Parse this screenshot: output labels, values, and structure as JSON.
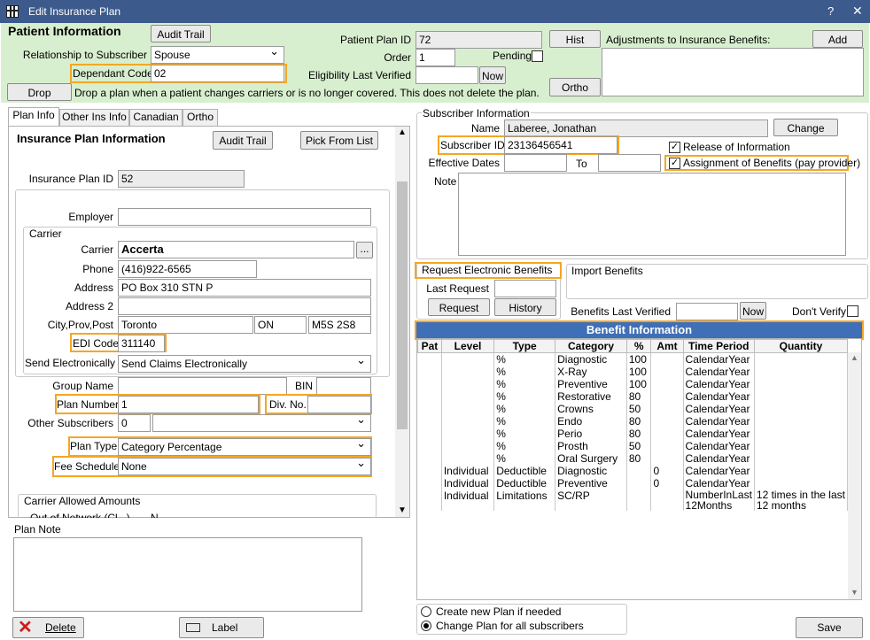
{
  "window": {
    "title": "Edit Insurance Plan",
    "help": "?",
    "close": "✕"
  },
  "patient": {
    "heading": "Patient Information",
    "audit_trail": "Audit Trail",
    "rel_label": "Relationship to Subscriber",
    "rel_value": "Spouse",
    "dep_label": "Dependant Code",
    "dep_value": "02",
    "drop": "Drop",
    "drop_note": "Drop a plan when a patient changes carriers or is no longer covered.  This does not delete the plan.",
    "ppid_label": "Patient Plan ID",
    "ppid_value": "72",
    "hist": "Hist",
    "order_label": "Order",
    "order_value": "1",
    "pending_label": "Pending",
    "elv_label": "Eligibility Last Verified",
    "elv_value": "",
    "now": "Now",
    "ortho": "Ortho",
    "adj_label": "Adjustments to Insurance Benefits:",
    "add": "Add"
  },
  "tabs": [
    "Plan Info",
    "Other Ins Info",
    "Canadian",
    "Ortho"
  ],
  "plan": {
    "heading": "Insurance Plan Information",
    "audit_trail": "Audit Trail",
    "pick": "Pick From List",
    "ipid_label": "Insurance Plan ID",
    "ipid_value": "52",
    "employer_label": "Employer",
    "employer_value": "",
    "carrier_group": "Carrier",
    "carrier_label": "Carrier",
    "carrier_value": "Accerta",
    "ellipsis": "...",
    "phone_label": "Phone",
    "phone_value": "(416)922-6565",
    "addr_label": "Address",
    "addr_value": "PO Box 310  STN P",
    "addr2_label": "Address 2",
    "addr2_value": "",
    "city_label": "City,Prov,Post",
    "city_value": "Toronto",
    "prov_value": "ON",
    "post_value": "M5S 2S8",
    "edi_label": "EDI Code",
    "edi_value": "311140",
    "send_label": "Send Electronically",
    "send_value": "Send Claims Electronically",
    "group_label": "Group Name",
    "group_value": "",
    "bin_label": "BIN",
    "bin_value": "",
    "plannum_label": "Plan Number",
    "plannum_value": "1",
    "div_label": "Div. No.",
    "div_value": "",
    "othersubs_label": "Other Subscribers",
    "othersubs_value": "0",
    "plantype_label": "Plan Type",
    "plantype_value": "Category Percentage",
    "fee_label": "Fee Schedule",
    "fee_value": "None",
    "allowed_label": "Carrier Allowed Amounts",
    "allowed_cut": "Out of Network (Cl...)",
    "allowed_cut_value": "N",
    "note_label": "Plan Note"
  },
  "subscriber": {
    "group": "Subscriber Information",
    "name_label": "Name",
    "name_value": "Laberee, Jonathan",
    "change": "Change",
    "sid_label": "Subscriber ID",
    "sid_value": "23136456541",
    "release_label": "Release of Information",
    "eff_label": "Effective Dates",
    "to_label": "To",
    "assign_label": "Assignment of Benefits (pay provider)",
    "note_label": "Note"
  },
  "electronic": {
    "req_label": "Request Electronic Benefits",
    "last_label": "Last Request",
    "request": "Request",
    "history": "History",
    "import_label": "Import Benefits",
    "blv_label": "Benefits Last Verified",
    "now": "Now",
    "dont_verify": "Don't Verify"
  },
  "benefits": {
    "title": "Benefit Information",
    "columns": [
      "Pat",
      "Level",
      "Type",
      "Category",
      "%",
      "Amt",
      "Time Period",
      "Quantity"
    ],
    "rows": [
      [
        "",
        "",
        "%",
        "Diagnostic",
        "100",
        "",
        "CalendarYear",
        ""
      ],
      [
        "",
        "",
        "%",
        "X-Ray",
        "100",
        "",
        "CalendarYear",
        ""
      ],
      [
        "",
        "",
        "%",
        "Preventive",
        "100",
        "",
        "CalendarYear",
        ""
      ],
      [
        "",
        "",
        "%",
        "Restorative",
        "80",
        "",
        "CalendarYear",
        ""
      ],
      [
        "",
        "",
        "%",
        "Crowns",
        "50",
        "",
        "CalendarYear",
        ""
      ],
      [
        "",
        "",
        "%",
        "Endo",
        "80",
        "",
        "CalendarYear",
        ""
      ],
      [
        "",
        "",
        "%",
        "Perio",
        "80",
        "",
        "CalendarYear",
        ""
      ],
      [
        "",
        "",
        "%",
        "Prosth",
        "50",
        "",
        "CalendarYear",
        ""
      ],
      [
        "",
        "",
        "%",
        "Oral Surgery",
        "80",
        "",
        "CalendarYear",
        ""
      ],
      [
        "",
        "Individual",
        "Deductible",
        "Diagnostic",
        "",
        "0",
        "CalendarYear",
        ""
      ],
      [
        "",
        "Individual",
        "Deductible",
        "Preventive",
        "",
        "0",
        "CalendarYear",
        ""
      ],
      [
        "",
        "Individual",
        "Limitations",
        "SC/RP",
        "",
        "",
        "NumberInLast\n12Months",
        "12 times in the last\n12 months"
      ]
    ]
  },
  "footer": {
    "create": "Create new Plan if needed",
    "change_all": "Change Plan for all subscribers",
    "delete": "Delete",
    "label": "Label",
    "save": "Save"
  }
}
